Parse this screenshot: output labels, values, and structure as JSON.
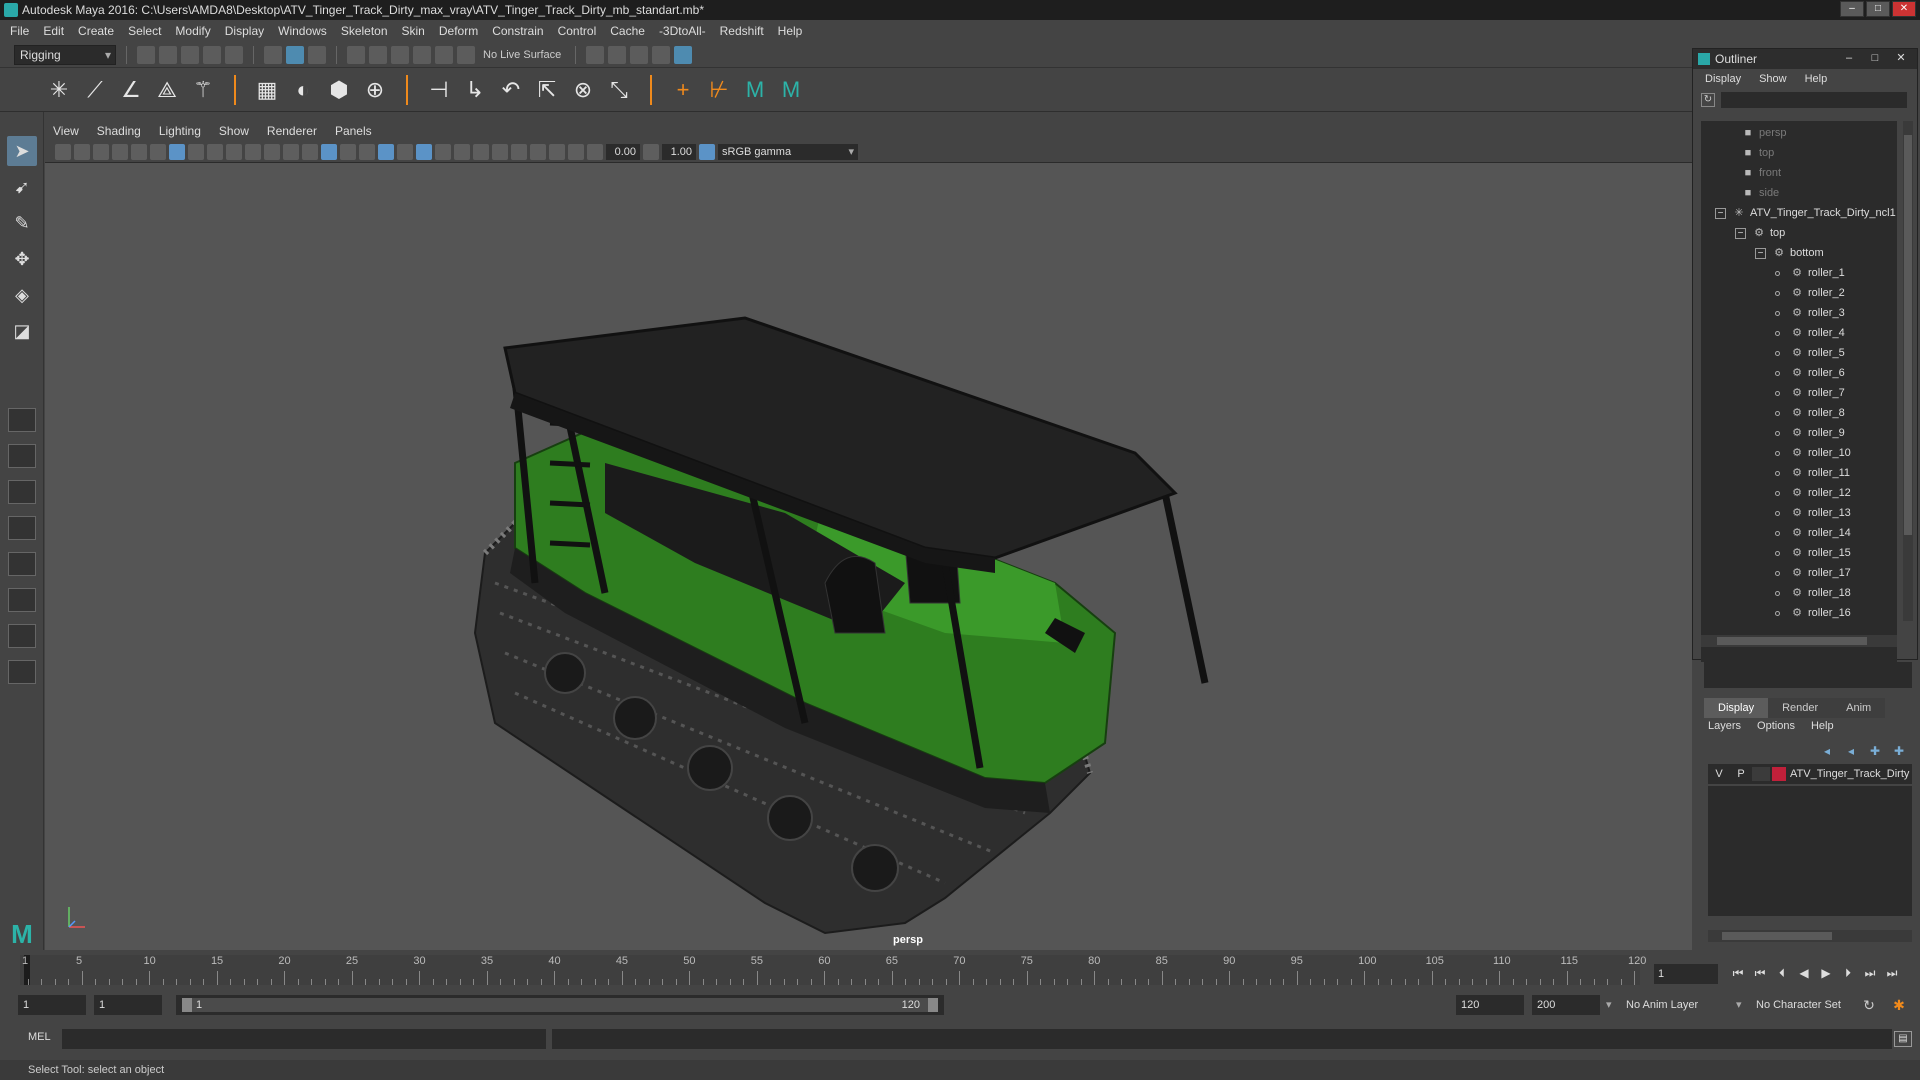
{
  "window": {
    "title": "Autodesk Maya 2016: C:\\Users\\AMDA8\\Desktop\\ATV_Tinger_Track_Dirty_max_vray\\ATV_Tinger_Track_Dirty_mb_standart.mb*",
    "minimize": "–",
    "maximize": "□",
    "close": "✕"
  },
  "menubar": [
    "File",
    "Edit",
    "Create",
    "Select",
    "Modify",
    "Display",
    "Windows",
    "Skeleton",
    "Skin",
    "Deform",
    "Constrain",
    "Control",
    "Cache",
    "-3DtoAll-",
    "Redshift",
    "Help"
  ],
  "statusline": {
    "mode": "Rigging",
    "live_surface": "No Live Surface"
  },
  "viewport": {
    "menus": [
      "View",
      "Shading",
      "Lighting",
      "Show",
      "Renderer",
      "Panels"
    ],
    "exposure": "0.00",
    "gamma": "1.00",
    "color_space": "sRGB gamma",
    "camera_label": "persp"
  },
  "outliner": {
    "title": "Outliner",
    "menus": [
      "Display",
      "Show",
      "Help"
    ],
    "cameras": [
      "persp",
      "top",
      "front",
      "side"
    ],
    "root": "ATV_Tinger_Track_Dirty_ncl1",
    "group_top": "top",
    "group_bottom": "bottom",
    "rollers": [
      "roller_1",
      "roller_2",
      "roller_3",
      "roller_4",
      "roller_5",
      "roller_6",
      "roller_7",
      "roller_8",
      "roller_9",
      "roller_10",
      "roller_11",
      "roller_12",
      "roller_13",
      "roller_14",
      "roller_15",
      "roller_17",
      "roller_18",
      "roller_16"
    ]
  },
  "layer_editor": {
    "tabs": [
      "Display",
      "Render",
      "Anim"
    ],
    "active_tab": "Display",
    "menus": [
      "Layers",
      "Options",
      "Help"
    ],
    "layer": {
      "visible": "V",
      "playback": "P",
      "name": "ATV_Tinger_Track_Dirty",
      "color": "#c0203a"
    }
  },
  "timeline": {
    "ticks": [
      "5",
      "10",
      "15",
      "20",
      "25",
      "30",
      "35",
      "40",
      "45",
      "50",
      "55",
      "60",
      "65",
      "70",
      "75",
      "80",
      "85",
      "90",
      "95",
      "100",
      "105",
      "110",
      "115",
      "120"
    ],
    "first_tick": "1",
    "current_frame": "1",
    "range_min": 1,
    "range_max": 120
  },
  "range": {
    "start": "1",
    "playback_start": "1",
    "slider_start": "1",
    "slider_end": "120",
    "playback_end": "120",
    "end": "200",
    "anim_layer": "No Anim Layer",
    "character_set": "No Character Set"
  },
  "command": {
    "language": "MEL"
  },
  "helpline": "Select Tool: select an object",
  "colors": {
    "maya_teal": "#2cb3a8",
    "accent_orange": "#f08a1c",
    "atv_green": "#2e7d1f"
  }
}
